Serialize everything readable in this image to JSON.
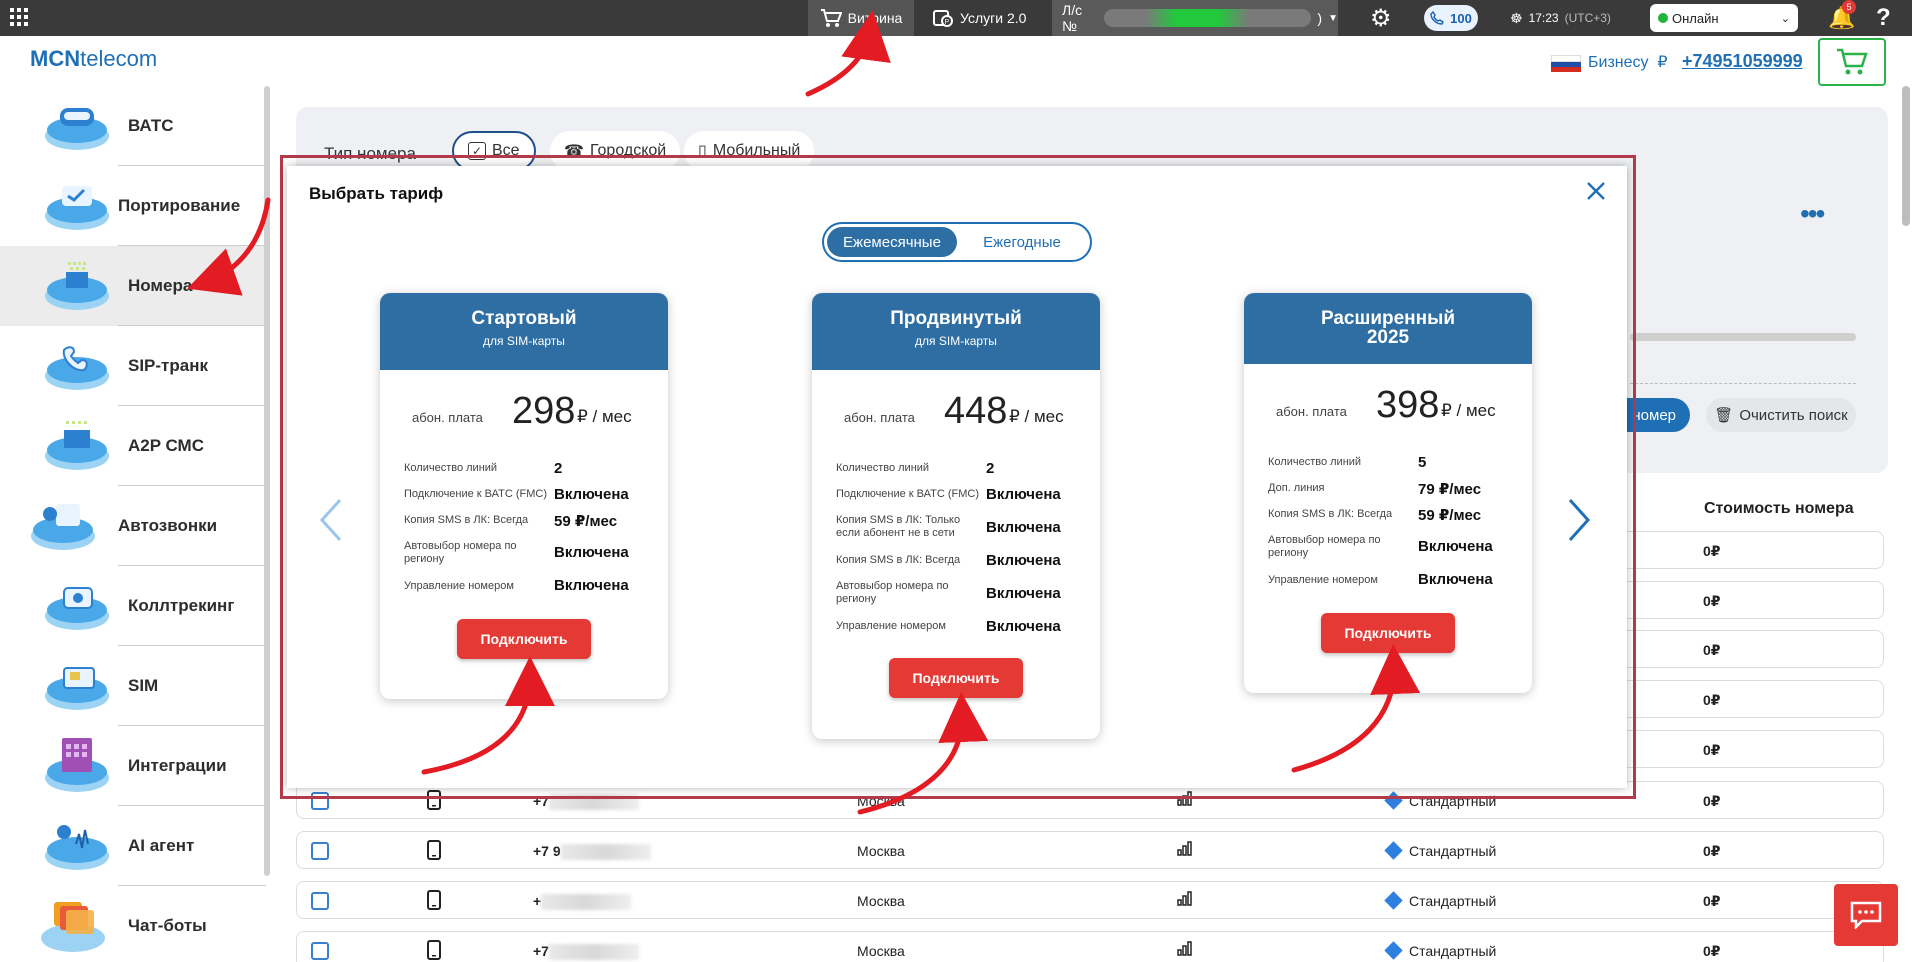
{
  "topbar": {
    "vitrina": "Витрина",
    "uslugi": "Услуги 2.0",
    "account_prefix": "Л/с №",
    "account_suffix": ")",
    "calls": "100",
    "time": "17:23",
    "timezone": "(UTC+3)",
    "status": "Онлайн",
    "notifications": "5"
  },
  "header": {
    "logo_bold": "MCN",
    "logo_thin": "telecom",
    "business": "Бизнесу",
    "currency": "₽",
    "phone": "+74951059999"
  },
  "sidebar": {
    "items": [
      {
        "label": "ВАТС"
      },
      {
        "label": "Портирование"
      },
      {
        "label": "Номера"
      },
      {
        "label": "SIP-транк"
      },
      {
        "label": "A2P СМС"
      },
      {
        "label": "Автозвонки"
      },
      {
        "label": "Коллтрекинг"
      },
      {
        "label": "SIM"
      },
      {
        "label": "Интеграции"
      },
      {
        "label": "AI агент"
      },
      {
        "label": "Чат-боты"
      }
    ]
  },
  "filters": {
    "type_label": "Тип номера",
    "chip_all": "Все",
    "chip_city": "Городской",
    "chip_mobile": "Мобильный",
    "search_btn": "номер",
    "clear_btn": "Очистить поиск",
    "col_price": "Стоимость номера"
  },
  "rows": [
    {
      "num": "+7",
      "city": "Москва",
      "tariff": "Стандартный",
      "price": "0₽"
    },
    {
      "num": "+7 9",
      "city": "Москва",
      "tariff": "Стандартный",
      "price": "0₽"
    },
    {
      "num": "+",
      "city": "Москва",
      "tariff": "Стандартный",
      "price": "0₽"
    },
    {
      "num": "+7",
      "city": "Москва",
      "tariff": "Стандартный",
      "price": "0₽"
    }
  ],
  "hidden_prices": [
    "0₽",
    "0₽",
    "0₽",
    "0₽",
    "0₽"
  ],
  "modal": {
    "title": "Выбрать тариф",
    "toggle_monthly": "Ежемесячные",
    "toggle_yearly": "Ежегодные",
    "fee_label": "абон. плата",
    "fee_unit": "₽ / мес",
    "connect": "Подключить",
    "cards": [
      {
        "title": "Стартовый",
        "subtitle": "для SIM-карты",
        "price": "298",
        "features": [
          {
            "k": "Количество линий",
            "v": "2"
          },
          {
            "k": "Подключение к ВАТС (FMC)",
            "v": "Включена"
          },
          {
            "k": "Копия SMS в ЛК: Всегда",
            "v": "59 ₽/мес"
          },
          {
            "k": "Автовыбор номера по региону",
            "v": "Включена"
          },
          {
            "k": "Управление номером",
            "v": "Включена"
          }
        ]
      },
      {
        "title": "Продвинутый",
        "subtitle": "для SIM-карты",
        "price": "448",
        "features": [
          {
            "k": "Количество линий",
            "v": "2"
          },
          {
            "k": "Подключение к ВАТС (FMC)",
            "v": "Включена"
          },
          {
            "k": "Копия SMS в ЛК: Только если абонент не в сети",
            "v": "Включена"
          },
          {
            "k": "Копия SMS в ЛК: Всегда",
            "v": "Включена"
          },
          {
            "k": "Автовыбор номера по региону",
            "v": "Включена"
          },
          {
            "k": "Управление номером",
            "v": "Включена"
          }
        ]
      },
      {
        "title": "Расширенный 2025",
        "subtitle": "",
        "price": "398",
        "features": [
          {
            "k": "Количество линий",
            "v": "5"
          },
          {
            "k": "Доп. линия",
            "v": "79 ₽/мес"
          },
          {
            "k": "Копия SMS в ЛК: Всегда",
            "v": "59 ₽/мес"
          },
          {
            "k": "Автовыбор номера по региону",
            "v": "Включена"
          },
          {
            "k": "Управление номером",
            "v": "Включена"
          }
        ]
      }
    ]
  },
  "colors": {
    "accent": "#1f6fb5",
    "card_header": "#2f6ea3",
    "cta": "#e53935",
    "online": "#1fb53a"
  }
}
